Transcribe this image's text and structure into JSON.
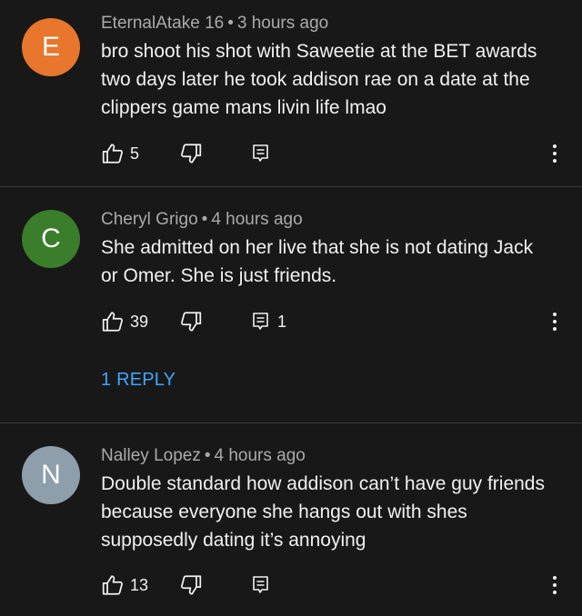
{
  "comments": [
    {
      "avatar_letter": "E",
      "avatar_color": "#e8762c",
      "author": "EternalAtake 16",
      "time": "3 hours ago",
      "lines": [
        "bro shoot his shot with Saweetie at the BET awards",
        "two days later he took addison rae on a date at the",
        "clippers game mans livin life lmao"
      ],
      "likes": "5",
      "replies": ""
    },
    {
      "avatar_letter": "C",
      "avatar_color": "#3a7d2a",
      "author": "Cheryl Grigo",
      "time": "4 hours ago",
      "lines": [
        "She admitted on her live that she is not dating Jack",
        "or Omer.  She is just friends."
      ],
      "likes": "39",
      "replies": "1",
      "reply_link": "1 REPLY"
    },
    {
      "avatar_letter": "N",
      "avatar_color": "#8e9eab",
      "author": "Nalley Lopez",
      "time": "4 hours ago",
      "lines": [
        "Double standard how addison can’t have guy friends",
        "because everyone she hangs out with shes",
        "supposedly dating it’s annoying"
      ],
      "likes": "13",
      "replies": ""
    }
  ],
  "separator": "•",
  "icons": [
    "thumbs-up-icon",
    "thumbs-down-icon",
    "reply-icon",
    "more-vert-icon"
  ],
  "colors": {
    "background": "#181818",
    "text": "#f1f1f1",
    "meta": "#aaaaaa",
    "link": "#3ea6ff"
  }
}
